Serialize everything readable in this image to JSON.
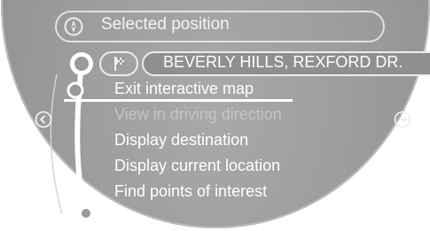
{
  "header": {
    "title": "Selected position",
    "icon": "compass-icon"
  },
  "destination": {
    "address": "BEVERLY HILLS, REXFORD DR.",
    "icon": "flag-icon"
  },
  "menu": {
    "items": [
      {
        "label": "Exit interactive map",
        "enabled": true,
        "selected": true
      },
      {
        "label": "View in driving direction",
        "enabled": false,
        "selected": false
      },
      {
        "label": "Display destination",
        "enabled": true,
        "selected": false
      },
      {
        "label": "Display current location",
        "enabled": true,
        "selected": false
      },
      {
        "label": "Find points of interest",
        "enabled": true,
        "selected": false
      }
    ]
  },
  "navigation": {
    "left_icon": "arrow-left-icon",
    "right_icon": "arrow-right-icon"
  },
  "colors": {
    "display_bg": "#9a9a9a",
    "text": "#ffffff",
    "disabled_text": "#c4c4c4",
    "outline": "#e8e8e8"
  }
}
